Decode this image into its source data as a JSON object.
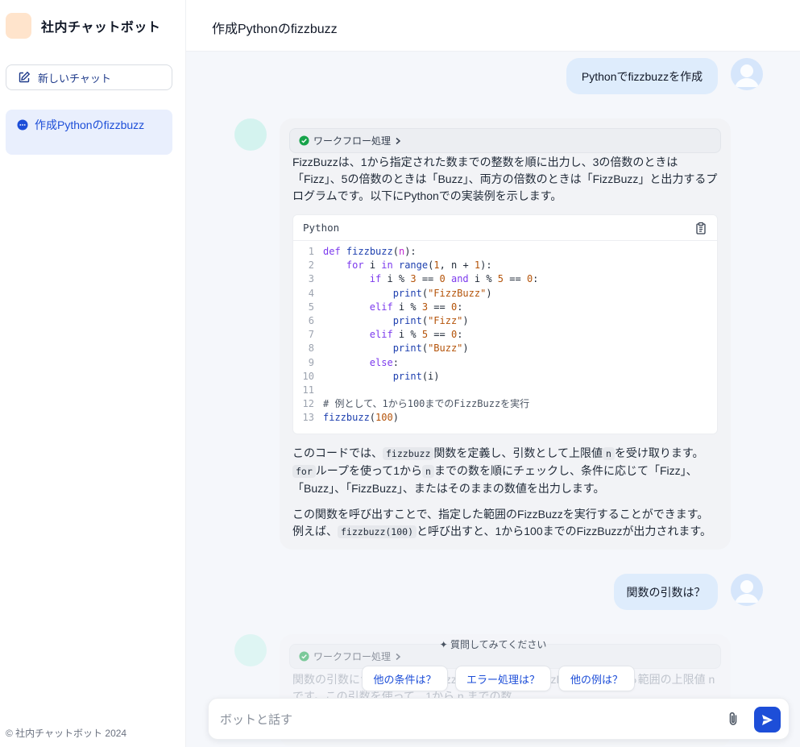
{
  "app": {
    "name": "社内チャットボット",
    "copyright": "© 社内チャットボット 2024"
  },
  "sidebar": {
    "new_chat_label": "新しいチャット",
    "conversations": [
      {
        "label": "作成Pythonのfizzbuzz"
      }
    ]
  },
  "header": {
    "title": "作成Pythonのfizzbuzz"
  },
  "messages": {
    "user1": "Pythonでfizzbuzzを作成",
    "user2": "関数の引数は？",
    "workflow_label": "ワークフロー処理",
    "bot": {
      "intro": "FizzBuzzは、1から指定された数までの整数を順に出力し、3の倍数のときは「Fizz」、5の倍数のときは「Buzz」、両方の倍数のときは「FizzBuzz」と出力するプログラムです。以下にPythonでの実装例を示します。",
      "code_language": "Python",
      "code_lines": [
        "def fizzbuzz(n):",
        "    for i in range(1, n + 1):",
        "        if i % 3 == 0 and i % 5 == 0:",
        "            print(\"FizzBuzz\")",
        "        elif i % 3 == 0:",
        "            print(\"Fizz\")",
        "        elif i % 5 == 0:",
        "            print(\"Buzz\")",
        "        else:",
        "            print(i)",
        "",
        "# 例として、1から100までのFizzBuzzを実行",
        "fizzbuzz(100)"
      ],
      "p2_a": "このコードでは、",
      "p2_code1": "fizzbuzz",
      "p2_b": "関数を定義し、引数として上限値",
      "p2_code2": "n",
      "p2_c": "を受け取ります。",
      "p2_code3": "for",
      "p2_d": "ループを使って1から",
      "p2_code4": "n",
      "p2_e": "までの数を順にチェックし、条件に応じて「Fizz」、「Buzz」、「FizzBuzz」、またはそのままの数値を出力します。",
      "p3_a": "この関数を呼び出すことで、指定した範囲のFizzBuzzを実行することができます。例えば、",
      "p3_code": "fizzbuzz(100)",
      "p3_b": "と呼び出すと、1から100までのFizzBuzzが出力されます。"
    },
    "bot2_partial": "関数の引数については、fizzbuzz関数の引数は、FizzBuzzを実行する範囲の上限値 n です。この引数を使って、1から n までの数"
  },
  "suggestions": {
    "title": "✦ 質問してみてください",
    "chips": [
      "他の条件は？",
      "エラー処理は？",
      "他の例は？"
    ]
  },
  "composer": {
    "placeholder": "ボットと話す"
  }
}
